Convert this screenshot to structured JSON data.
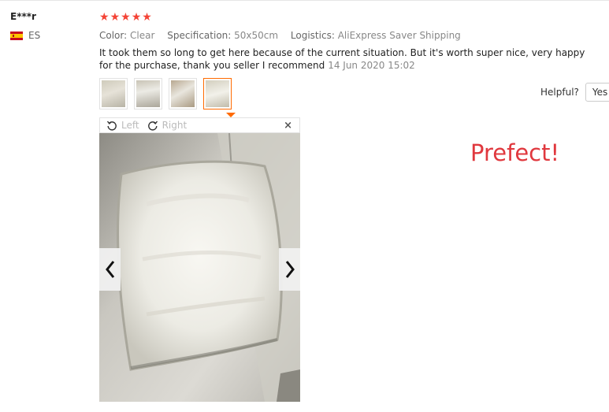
{
  "reviewer": {
    "name": "E***r",
    "country_code": "ES",
    "flag_icon": "spain-flag-icon"
  },
  "rating": {
    "stars": 5,
    "color": "#f44336"
  },
  "properties": [
    {
      "key": "Color:",
      "value": "Clear"
    },
    {
      "key": "Specification:",
      "value": "50x50cm"
    },
    {
      "key": "Logistics:",
      "value": "AliExpress Saver Shipping"
    }
  ],
  "feedback": {
    "text": "It took them so long to get here because of the current situation. But it's worth super nice, very happy for the purchase, thank you seller I recommend",
    "date": "14 Jun 2020 15:02"
  },
  "helpful": {
    "label": "Helpful?",
    "yes_label": "Yes ("
  },
  "viewer": {
    "rotate_left_label": "Left",
    "rotate_right_label": "Right",
    "close_glyph": "×",
    "active_thumb_color": "#ff6a00"
  },
  "annotation": {
    "text": "Prefect!",
    "color": "#e0383e"
  }
}
